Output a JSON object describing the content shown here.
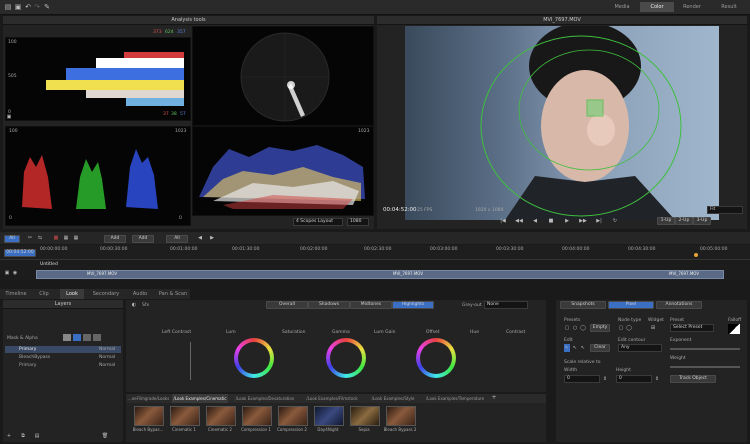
{
  "top_tabs": [
    "Media",
    "Color",
    "Render",
    "Result"
  ],
  "scopes": {
    "title": "Analysis tools",
    "histogram_values": [
      "373",
      "624",
      "357"
    ],
    "histogram_values2": [
      "37",
      "38",
      "57"
    ],
    "hist_ticks": [
      "100",
      "505",
      "0"
    ],
    "parade_ticks_left": [
      "100",
      "90",
      "80",
      "70",
      "60",
      "50",
      "40",
      "30",
      "20",
      "10",
      "0"
    ],
    "parade_ticks_right": [
      "1023",
      "912",
      "824",
      "723",
      "616",
      "512",
      "414",
      "316",
      "204",
      "102",
      "0"
    ],
    "layout_select": "4 Scopes Layout",
    "res_select": "1080"
  },
  "viewer": {
    "title": "MVI_7697.MOV",
    "timecode": "00:04:52:00",
    "fps": "25 FPS",
    "res": "1920 x 1080",
    "fit": "Fit",
    "view_btns": [
      "1-Up",
      "2-Up",
      "3-Up"
    ]
  },
  "timeline": {
    "add_btn": "Add",
    "all_btn": "All",
    "add2": "Add",
    "all2": "All",
    "ruler": [
      "00:00:00:00",
      "00:00:30:00",
      "00:01:00:00",
      "00:01:30:00",
      "00:02:00:00",
      "00:02:30:00",
      "00:03:00:00",
      "00:03:30:00",
      "00:04:00:00",
      "00:04:30:00",
      "00:05:00:00"
    ],
    "track_name": "Untitled",
    "clip_name": "MVI_7697.MOV",
    "clip_name2": "MVI_7697.MOV",
    "clip_name3": "MVI_7697.MOV",
    "current_tc": "00:04:52:00"
  },
  "bottom_tabs": [
    "Timeline",
    "Clip",
    "Look",
    "Secondary",
    "Audio",
    "Pan & Scan"
  ],
  "layers": {
    "title": "Layers",
    "mask_label": "Mask & Alpha",
    "items": [
      {
        "name": "Primary",
        "mode": "Normal"
      },
      {
        "name": "BleachBypass",
        "mode": "Normal"
      },
      {
        "name": "Primary",
        "mode": "Normal"
      }
    ]
  },
  "grade": {
    "lift_label": "Sfx",
    "range_tabs": [
      "Overall",
      "Shadows",
      "Midtones",
      "Highlights"
    ],
    "greyout_label": "Grey-out",
    "greyout_value": "None",
    "params": [
      "Left Contrast",
      "Lum",
      "Saturation",
      "Gamma",
      "Lum Gain",
      "Offset",
      "Hue",
      "Contrast"
    ]
  },
  "looks": {
    "tabs": [
      "...eeFilmgrade/Looks",
      "/Look Examples/Cinematic",
      "/Look Examples/Desaturation",
      "/Look Examples/Filmstock",
      "/Look Examples/Style",
      "/Look Examples/Temperature"
    ],
    "thumbs": [
      "Bleach Bypas...",
      "Cinematic 1",
      "Cinematic 2",
      "Compression 1",
      "Compression 2",
      "Day4Night",
      "Sepia",
      "Bleach Bypass 2"
    ]
  },
  "right_panel": {
    "tabs": [
      "Snapshots",
      "Pixel",
      "Annotations"
    ],
    "presets_label": "Presets",
    "node_type_label": "Node type",
    "widget_label": "Widget",
    "preset_label": "Preset",
    "falloff_label": "Falloff",
    "empty_btn": "Empty",
    "select_preset": "Select Preset",
    "edit_label": "Edit",
    "edit_contour_label": "Edit contour",
    "any_value": "Any",
    "clear_btn": "Clear",
    "exponent_label": "Exponent",
    "weight_label": "Weight",
    "scale_relative": "Scale relative to",
    "width_label": "Width",
    "height_label": "Height",
    "width_value": "0",
    "height_value": "0",
    "track_btn": "Track Object"
  },
  "colors": {
    "accent": "#3a6fc4",
    "active_tab": "#4a4a4a",
    "timeline_bar": "#5a6a86",
    "marker": "#e8a23a"
  }
}
